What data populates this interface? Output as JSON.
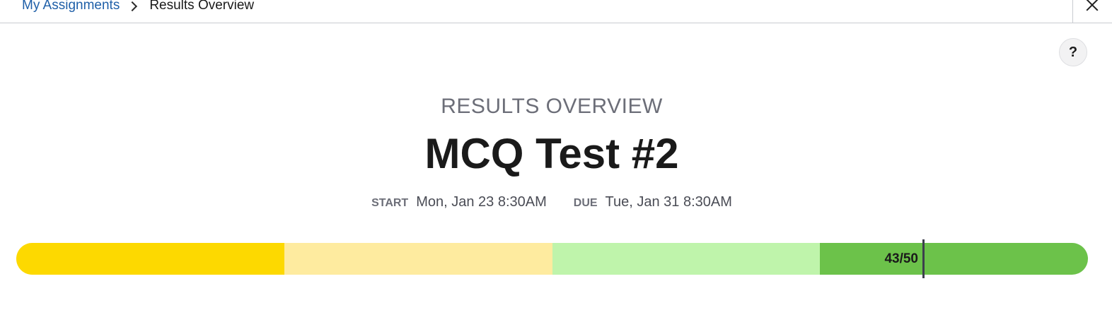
{
  "breadcrumb": {
    "link_label": "My Assignments",
    "current_label": "Results Overview"
  },
  "icons": {
    "breadcrumb_separator": "chevron-right-icon",
    "close": "close-icon",
    "help": "help-icon"
  },
  "help_label": "?",
  "header": {
    "subtitle": "RESULTS OVERVIEW",
    "title": "MCQ Test #2"
  },
  "dates": {
    "start_label": "START",
    "start_value": "Mon, Jan 23 8:30AM",
    "due_label": "DUE",
    "due_value": "Tue, Jan 31 8:30AM"
  },
  "score": {
    "label": "43/50",
    "earned": 43,
    "total": 50,
    "band_colors": [
      "#fdd900",
      "#feeb9f",
      "#bff4ab",
      "#6cc24a"
    ],
    "marker_color": "#3d3f4d"
  }
}
